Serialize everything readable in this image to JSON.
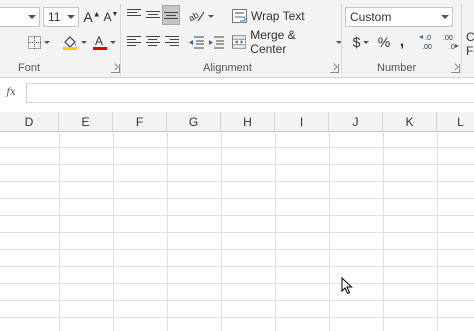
{
  "ribbon": {
    "font": {
      "size_value": "11",
      "group_label": "Font",
      "icons": [
        "increase-font-size-icon",
        "decrease-font-size-icon",
        "borders-icon",
        "fill-color-icon",
        "font-color-icon"
      ]
    },
    "alignment": {
      "wrap_text_label": "Wrap Text",
      "merge_center_label": "Merge & Center",
      "group_label": "Alignment"
    },
    "number": {
      "format_value": "Custom",
      "currency_symbol": "$",
      "percent_symbol": "%",
      "comma_symbol": ",",
      "increase_decimal_label": "←.0\n.00",
      "decrease_decimal_label": ".00\n→.0",
      "group_label": "Number"
    },
    "styles": {
      "partial_label_top": "C",
      "partial_label_bottom": "Fo"
    },
    "accent_red": "#e00000",
    "accent_yellow": "#f5d000"
  },
  "formula_bar": {
    "fx_label": "fx",
    "value": ""
  },
  "sheet": {
    "columns": [
      "D",
      "E",
      "F",
      "G",
      "H",
      "I",
      "J",
      "K",
      "L"
    ]
  }
}
